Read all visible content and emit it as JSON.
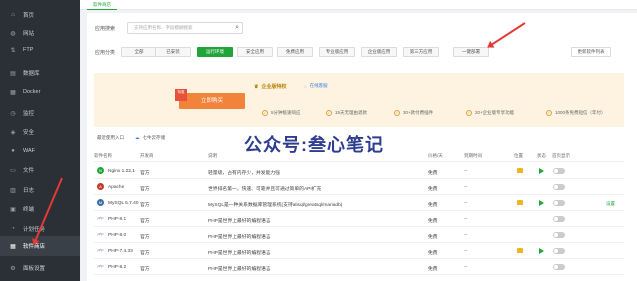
{
  "sidebar": {
    "items": [
      {
        "label": "首页",
        "icon": "home-icon",
        "glyph": "⌂"
      },
      {
        "label": "网站",
        "icon": "globe-icon",
        "glyph": "◍"
      },
      {
        "label": "FTP",
        "icon": "ftp-icon",
        "glyph": "⇅"
      },
      {
        "label": "数据库",
        "icon": "database-icon",
        "glyph": "▤"
      },
      {
        "label": "Docker",
        "icon": "docker-icon",
        "glyph": "▦"
      },
      {
        "label": "监控",
        "icon": "monitor-icon",
        "glyph": "◷"
      },
      {
        "label": "安全",
        "icon": "shield-icon",
        "glyph": "◈"
      },
      {
        "label": "WAF",
        "icon": "waf-icon",
        "glyph": "●"
      },
      {
        "label": "文件",
        "icon": "folder-icon",
        "glyph": "▭"
      },
      {
        "label": "日志",
        "icon": "log-icon",
        "glyph": "▥"
      },
      {
        "label": "终端",
        "icon": "terminal-icon",
        "glyph": "▣"
      },
      {
        "label": "计划任务",
        "icon": "clock-icon",
        "glyph": "◔"
      },
      {
        "label": "软件商店",
        "icon": "grid-icon",
        "glyph": "▦"
      },
      {
        "label": "面板设置",
        "icon": "gear-icon",
        "glyph": "⚙"
      }
    ],
    "active_index": 12
  },
  "topbar": {
    "tab_label": "软件商店"
  },
  "search": {
    "label": "应用搜索",
    "placeholder": "支持应用名称、字段模糊搜索"
  },
  "categories": {
    "label": "应用分类",
    "items": [
      "全部",
      "已安装",
      "运行环境",
      "安全应用",
      "免费应用",
      "专业版应用",
      "企业版应用",
      "第三方应用",
      "一键部署"
    ],
    "active_index": 2,
    "right_button": "更新软件列表"
  },
  "banner": {
    "button": "立即购买",
    "tag": "特惠",
    "title": "企业版特权",
    "link": "在线客服",
    "features": [
      "5分钟极速响应",
      "15天无理由退款",
      "30+款付费插件",
      "20+企业版专享功能",
      "1000条免费短信（年付）"
    ]
  },
  "watermark": "公众号:叁心笔记",
  "sublinks": {
    "guide": "最近使用入口",
    "cloud": "七牛云存储"
  },
  "table": {
    "headers": [
      "软件名称",
      "开发商",
      "说明",
      "价格/天",
      "到期时间",
      "位置",
      "状态",
      "首页显示"
    ],
    "rows": [
      {
        "name": "Nginx 1.22.1",
        "vendor": "官方",
        "desc": "轻量级，占有内存少，并发能力强",
        "price": "免费",
        "expire": "--",
        "icon_color": "#20a53a",
        "icon_glyph": "N",
        "has_actions": true,
        "has_setting": false
      },
      {
        "name": "Apache",
        "vendor": "官方",
        "desc": "世界排名第一，快速、可靠并且可通过简单的API扩充",
        "price": "免费",
        "expire": "--",
        "icon_color": "#c0392b",
        "icon_glyph": "A",
        "has_actions": false,
        "has_setting": false
      },
      {
        "name": "MySQL 5.7.40",
        "vendor": "官方",
        "desc": "MySQL是一种关系数据库管理系统(支持alisql/greatsql/mariadb)",
        "price": "免费",
        "expire": "--",
        "icon_color": "#3b6ea5",
        "icon_glyph": "M",
        "has_actions": true,
        "has_setting": true
      },
      {
        "name": "PHP-8.1",
        "vendor": "官方",
        "desc": "PHP是世界上最好的编程语言",
        "price": "免费",
        "expire": "--",
        "icon_color": "#7a86b8",
        "icon_glyph": "php",
        "has_actions": false,
        "has_setting": false
      },
      {
        "name": "PHP-8.0",
        "vendor": "官方",
        "desc": "PHP是世界上最好的编程语言",
        "price": "免费",
        "expire": "--",
        "icon_color": "#7a86b8",
        "icon_glyph": "php",
        "has_actions": false,
        "has_setting": false
      },
      {
        "name": "PHP-7.4.33",
        "vendor": "官方",
        "desc": "PHP是世界上最好的编程语言",
        "price": "免费",
        "expire": "--",
        "icon_color": "#7a86b8",
        "icon_glyph": "php",
        "has_actions": true,
        "has_setting": false
      },
      {
        "name": "PHP-8.2",
        "vendor": "官方",
        "desc": "PHP是世界上最好的编程语言",
        "price": "免费",
        "expire": "--",
        "icon_color": "#7a86b8",
        "icon_glyph": "php",
        "has_actions": false,
        "has_setting": false
      }
    ],
    "setting_link": "设置"
  },
  "colors": {
    "accent": "#20a53a",
    "sidebar_bg": "#2b3036",
    "annotation_arrow": "#e53935",
    "banner_bg": "#fdf3e0"
  }
}
